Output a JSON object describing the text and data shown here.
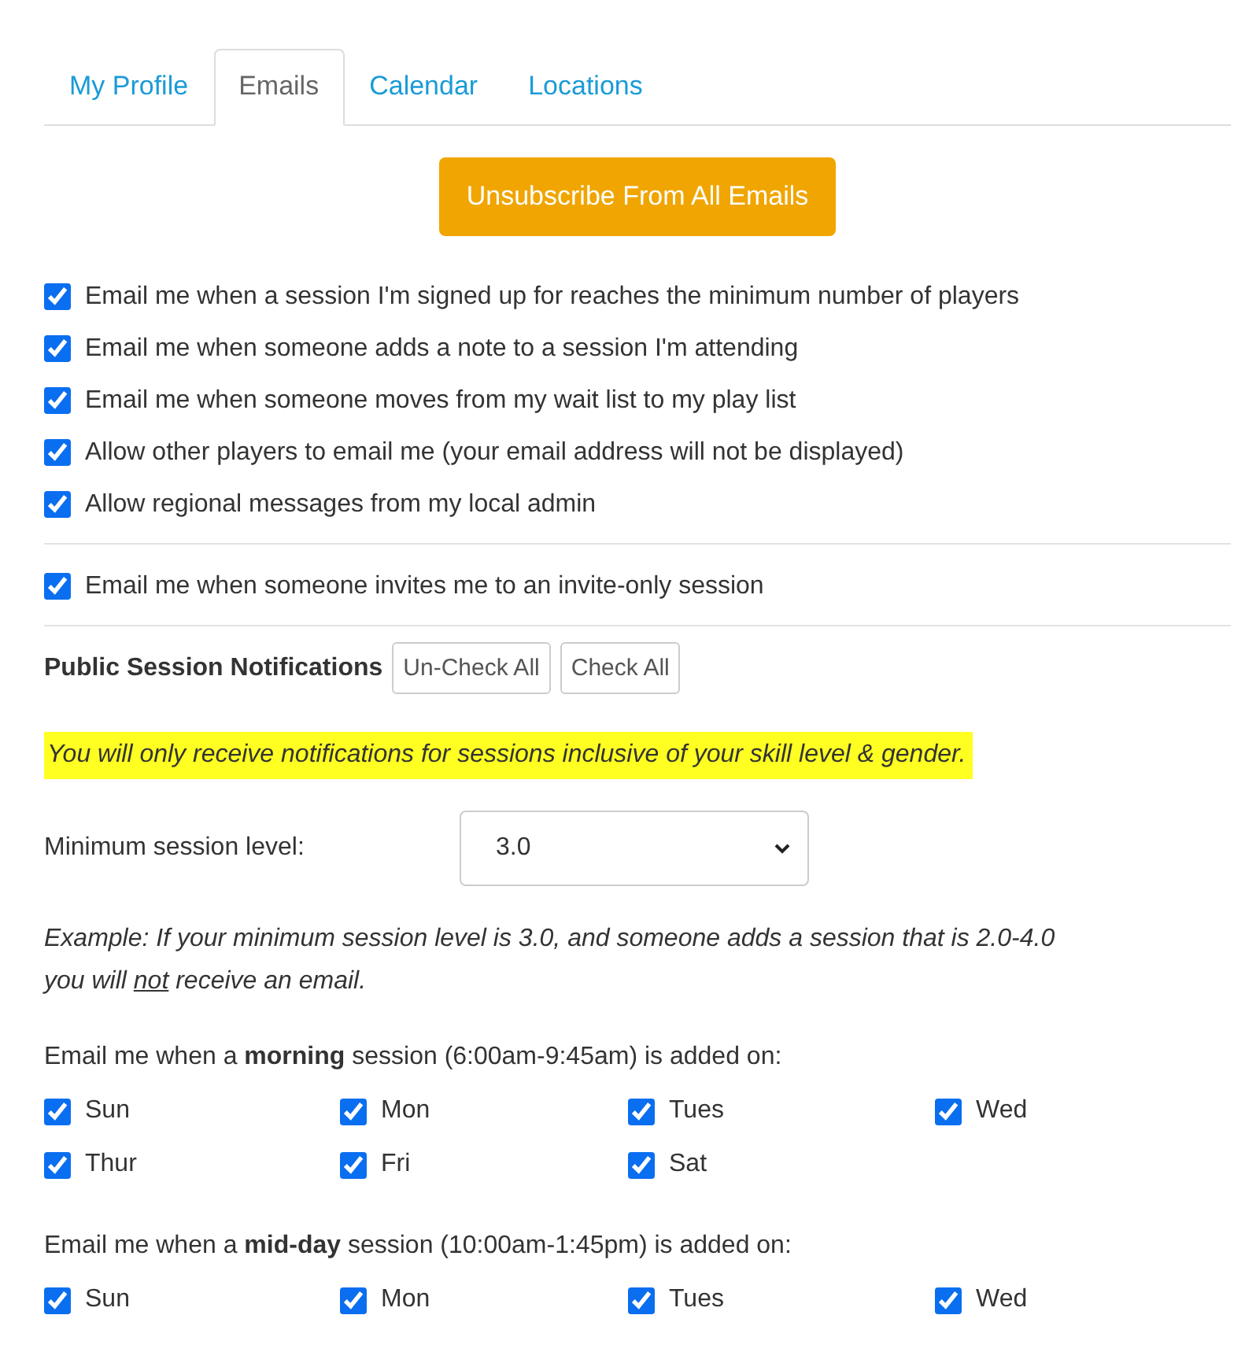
{
  "tabs": [
    {
      "label": "My Profile",
      "selected": false
    },
    {
      "label": "Emails",
      "selected": true
    },
    {
      "label": "Calendar",
      "selected": false
    },
    {
      "label": "Locations",
      "selected": false
    }
  ],
  "unsubscribe_button": "Unsubscribe From All Emails",
  "email_options": [
    {
      "label": "Email me when a session I'm signed up for reaches the minimum number of players",
      "checked": true
    },
    {
      "label": "Email me when someone adds a note to a session I'm attending",
      "checked": true
    },
    {
      "label": "Email me when someone moves from my wait list to my play list",
      "checked": true
    },
    {
      "label": "Allow other players to email me (your email address will not be displayed)",
      "checked": true
    },
    {
      "label": "Allow regional messages from my local admin",
      "checked": true
    }
  ],
  "invite_option": {
    "label": "Email me when someone invites me to an invite-only session",
    "checked": true
  },
  "public_notifications": {
    "title": "Public Session Notifications",
    "buttons": [
      "Un-Check All",
      "Check All"
    ],
    "notice": "You will only receive notifications for sessions inclusive of your skill level & gender.",
    "min_level": {
      "label": "Minimum session level:",
      "value": "3.0"
    },
    "example": "Example: If your minimum session level is 3.0, and someone adds a session that is 2.0-4.0 you will *not* receive an email.",
    "groups": [
      {
        "title": "Email me when a **morning** session (6:00am-9:45am) is added on:",
        "days": [
          {
            "label": "Sun",
            "checked": true
          },
          {
            "label": "Mon",
            "checked": true
          },
          {
            "label": "Tues",
            "checked": true
          },
          {
            "label": "Wed",
            "checked": true
          },
          {
            "label": "Thur",
            "checked": true
          },
          {
            "label": "Fri",
            "checked": true
          },
          {
            "label": "Sat",
            "checked": true
          }
        ]
      },
      {
        "title": "Email me when a **mid-day** session (10:00am-1:45pm) is added on:",
        "days": [
          {
            "label": "Sun",
            "checked": true
          },
          {
            "label": "Mon",
            "checked": true
          },
          {
            "label": "Tues",
            "checked": true
          },
          {
            "label": "Wed",
            "checked": true
          }
        ]
      }
    ]
  }
}
